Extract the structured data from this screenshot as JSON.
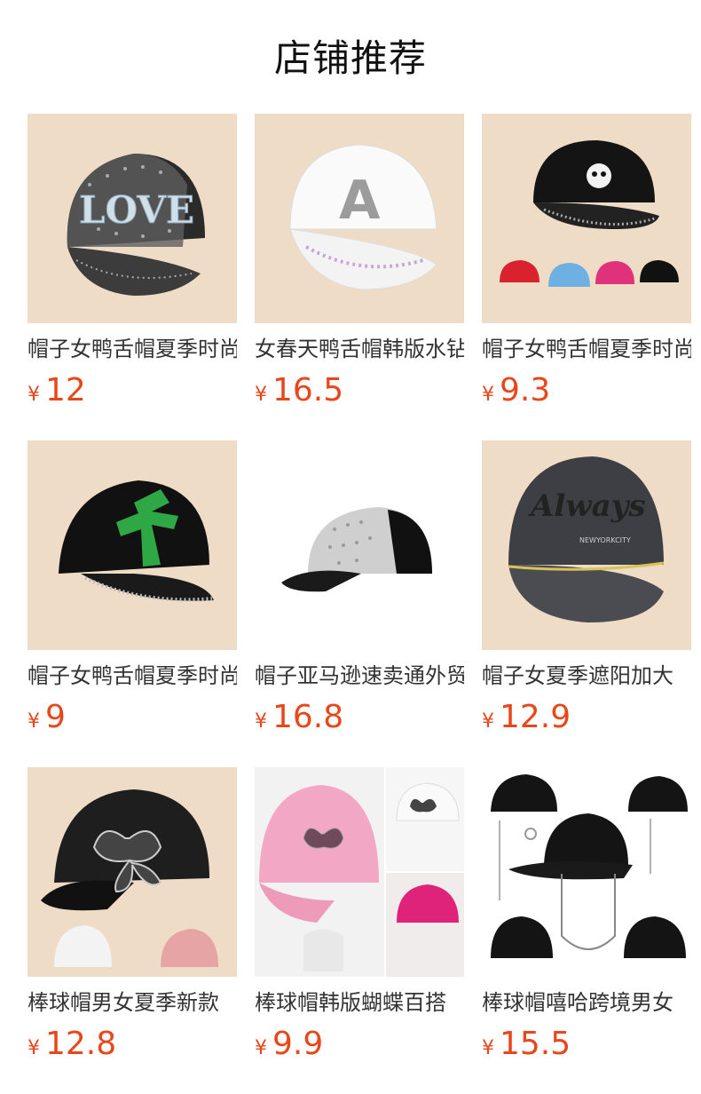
{
  "header": {
    "title": "店铺推荐"
  },
  "products": [
    {
      "name": "帽子女鸭舌帽夏季时尚",
      "price": "12",
      "currency": "¥",
      "image": "love-rhinestone-cap"
    },
    {
      "name": "女春天鸭舌帽韩版水钻",
      "price": "16.5",
      "currency": "¥",
      "image": "white-a-letter-cap"
    },
    {
      "name": "帽子女鸭舌帽夏季时尚",
      "price": "9.3",
      "currency": "¥",
      "image": "black-skull-cap-set"
    },
    {
      "name": "帽子女鸭舌帽夏季时尚",
      "price": "9",
      "currency": "¥",
      "image": "green-cross-cap"
    },
    {
      "name": "帽子亚马逊速卖通外贸",
      "price": "16.8",
      "currency": "¥",
      "image": "full-rhinestone-cap"
    },
    {
      "name": "帽子女夏季遮阳加大",
      "price": "12.9",
      "currency": "¥",
      "image": "always-washed-cap"
    },
    {
      "name": "棒球帽男女夏季新款",
      "price": "12.8",
      "currency": "¥",
      "image": "butterfly-mesh-cap"
    },
    {
      "name": "棒球帽韩版蝴蝶百搭",
      "price": "9.9",
      "currency": "¥",
      "image": "pink-butterfly-cap"
    },
    {
      "name": "棒球帽嘻哈跨境男女",
      "price": "15.5",
      "currency": "¥",
      "image": "chain-hiphop-cap"
    }
  ]
}
